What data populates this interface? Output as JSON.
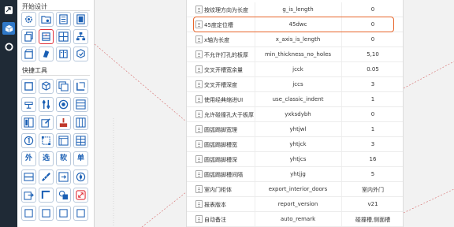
{
  "left_strip": {
    "items": [
      {
        "icon": "share-icon"
      },
      {
        "icon": "cube-icon"
      },
      {
        "icon": "ring-icon"
      }
    ],
    "accent": "#1f2a36"
  },
  "palette": {
    "section_start_title": "开始设计",
    "section_quick_title": "快捷工具",
    "start_tools": [
      {
        "icon": "gear-icon"
      },
      {
        "icon": "folder-gear-icon"
      },
      {
        "icon": "panel-icon"
      },
      {
        "icon": "door-panel-icon"
      },
      {
        "icon": "copy-icon"
      },
      {
        "icon": "drawer-icon"
      },
      {
        "icon": "cabinet-grid-icon"
      },
      {
        "icon": "hierarchy-icon"
      },
      {
        "icon": "box-open-icon"
      },
      {
        "icon": "rotate-icon"
      },
      {
        "icon": "book-icon"
      },
      {
        "icon": "cube-check-icon"
      }
    ],
    "quick_tools": [
      {
        "icon": "box-icon",
        "text": ""
      },
      {
        "icon": "cube-3d-icon",
        "text": ""
      },
      {
        "icon": "layers-icon",
        "text": ""
      },
      {
        "icon": "frame-icon",
        "text": ""
      },
      {
        "icon": "drill-icon",
        "text": ""
      },
      {
        "icon": "tools-icon",
        "text": ""
      },
      {
        "icon": "circle-target-icon",
        "text": ""
      },
      {
        "icon": "shelf-icon",
        "text": ""
      },
      {
        "icon": "door-icon",
        "text": ""
      },
      {
        "icon": "edit-panel-icon",
        "text": ""
      },
      {
        "icon": "brush-icon",
        "text": ""
      },
      {
        "icon": "wardrobe-icon",
        "text": ""
      },
      {
        "icon": "number-one-icon",
        "text": ""
      },
      {
        "icon": "rectangle-select-icon",
        "text": ""
      },
      {
        "icon": "grid-icon",
        "text": ""
      },
      {
        "icon": "table-icon",
        "text": ""
      },
      {
        "icon": "",
        "text": "外"
      },
      {
        "icon": "",
        "text": "选"
      },
      {
        "icon": "",
        "text": "软"
      },
      {
        "icon": "",
        "text": "单"
      },
      {
        "icon": "split-icon",
        "text": ""
      },
      {
        "icon": "ruler-icon",
        "text": ""
      },
      {
        "icon": "arrow-box-icon",
        "text": ""
      },
      {
        "icon": "compass-icon",
        "text": ""
      },
      {
        "icon": "export-icon",
        "text": ""
      },
      {
        "icon": "corner-icon",
        "text": ""
      },
      {
        "icon": "shapes-icon",
        "text": ""
      },
      {
        "icon": "resize-icon",
        "text": ""
      }
    ],
    "selected_color": "#e0303a",
    "icon_color": "#1a5fb4"
  },
  "parameters": {
    "rows": [
      {
        "name": "按纹理方向为长度",
        "key": "g_is_length",
        "value": "0"
      },
      {
        "name": "45度定位槽",
        "key": "45dwc",
        "value": "0"
      },
      {
        "name": "x轴为长度",
        "key": "x_axis_is_length",
        "value": "0"
      },
      {
        "name": "不允许打孔的板厚",
        "key": "min_thickness_no_holes",
        "value": "5,10"
      },
      {
        "name": "交叉开槽宽余量",
        "key": "jcck",
        "value": "0.05"
      },
      {
        "name": "交叉开槽深度",
        "key": "jccs",
        "value": "3"
      },
      {
        "name": "使用经典缩进UI",
        "key": "use_classic_indent",
        "value": "1"
      },
      {
        "name": "允许碰撞孔大于板厚",
        "key": "yxksdybh",
        "value": "0"
      },
      {
        "name": "圆弧踢脚宽理",
        "key": "yhtjwl",
        "value": "1"
      },
      {
        "name": "圆弧踢脚槽宽",
        "key": "yhtjck",
        "value": "3"
      },
      {
        "name": "圆弧踢脚槽深",
        "key": "yhtjcs",
        "value": "16"
      },
      {
        "name": "圆弧踢脚槽间隔",
        "key": "yhtjjg",
        "value": "5"
      },
      {
        "name": "室内门柜体",
        "key": "export_interior_doors",
        "value": "室内外门"
      },
      {
        "name": "报表版本",
        "key": "report_version",
        "value": "v21"
      },
      {
        "name": "自动备注",
        "key": "auto_remark",
        "value": "碰撞槽,侧面槽"
      }
    ],
    "highlight_color": "#e8662b"
  }
}
